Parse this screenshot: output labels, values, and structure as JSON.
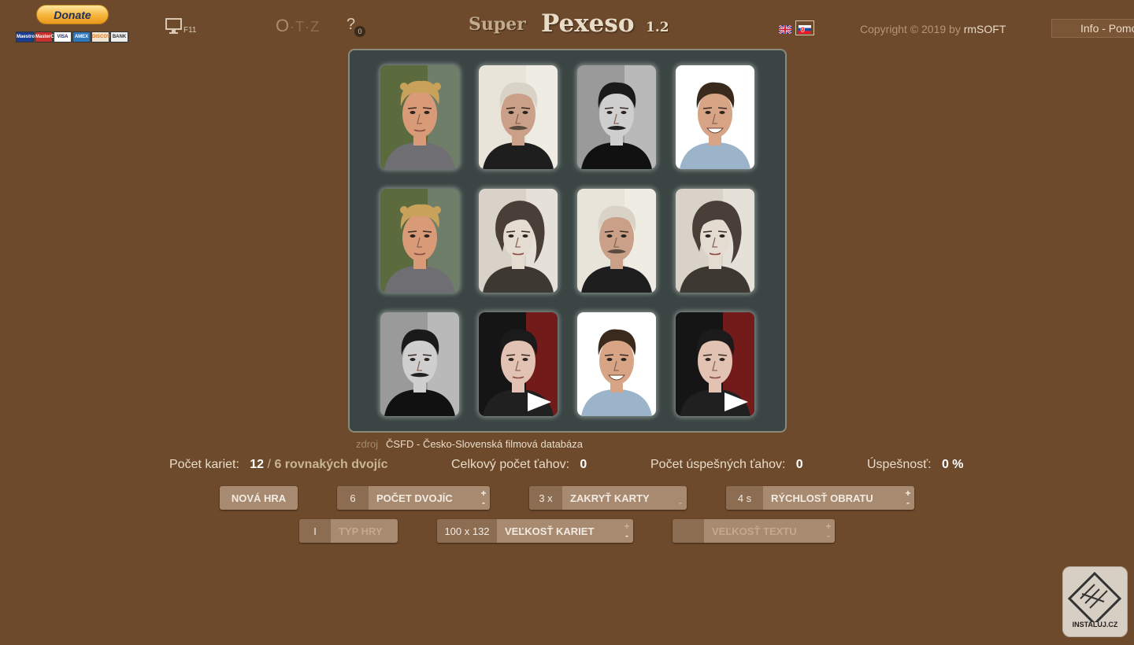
{
  "header": {
    "donate_label": "Donate",
    "payment_cards": [
      "Maestro",
      "MasterCard",
      "VISA",
      "AMEX",
      "DISCOVER",
      "BANK"
    ],
    "fullscreen_key": "F11",
    "otz_letters": [
      "O",
      "·",
      "T",
      "·",
      "Z"
    ],
    "help_label": "?",
    "help_count": "0",
    "title_prefix": "Super",
    "title_main": "Pexeso",
    "title_version": "1.2",
    "languages": [
      "en",
      "sk"
    ],
    "active_language": "sk",
    "copyright_prefix": "Copyright © 2019 by ",
    "copyright_owner": "rmSOFT",
    "info_label": "Info - Pomoc"
  },
  "board": {
    "cards": [
      {
        "face": "man-curly-blond",
        "pair": 1
      },
      {
        "face": "man-grey-mustache",
        "pair": 2
      },
      {
        "face": "man-bw-mustache",
        "pair": 3
      },
      {
        "face": "man-smiling-darkhair",
        "pair": 4
      },
      {
        "face": "man-curly-blond",
        "pair": 1
      },
      {
        "face": "woman-vintage",
        "pair": 5
      },
      {
        "face": "man-grey-mustache",
        "pair": 2
      },
      {
        "face": "woman-vintage",
        "pair": 5
      },
      {
        "face": "man-bw-mustache",
        "pair": 3
      },
      {
        "face": "man-dark-young",
        "pair": 6
      },
      {
        "face": "man-smiling-darkhair",
        "pair": 4
      },
      {
        "face": "man-dark-young",
        "pair": 6
      }
    ]
  },
  "source": {
    "prefix": "zdroj",
    "text": "ČSFD - Česko-Slovenská filmová databáza"
  },
  "stats": {
    "cards_label": "Počet kariet:",
    "cards_value": "12",
    "separator": "/",
    "pairs_text": "6 rovnakých dvojíc",
    "total_moves_label": "Celkový počet ťahov:",
    "total_moves_value": "0",
    "success_moves_label": "Počet úspešných ťahov:",
    "success_moves_value": "0",
    "success_rate_label": "Úspešnosť:",
    "success_rate_value": "0 %"
  },
  "controls": {
    "new_game": "NOVÁ HRA",
    "pairs_value": "6",
    "pairs_label": "POČET DVOJÍC",
    "hide_value": "3 x",
    "hide_label": "ZAKRYŤ KARTY",
    "speed_value": "4 s",
    "speed_label": "RÝCHLOSŤ OBRATU",
    "type_value": "I",
    "type_label": "TYP HRY",
    "size_value": "100 x 132",
    "size_label": "VEĽKOSŤ KARIET",
    "text_size_value": "",
    "text_size_label": "VEĽKOSŤ TEXTU",
    "plus": "+",
    "minus": "-"
  },
  "watermark": {
    "label": "INSTALUJ.CZ"
  }
}
